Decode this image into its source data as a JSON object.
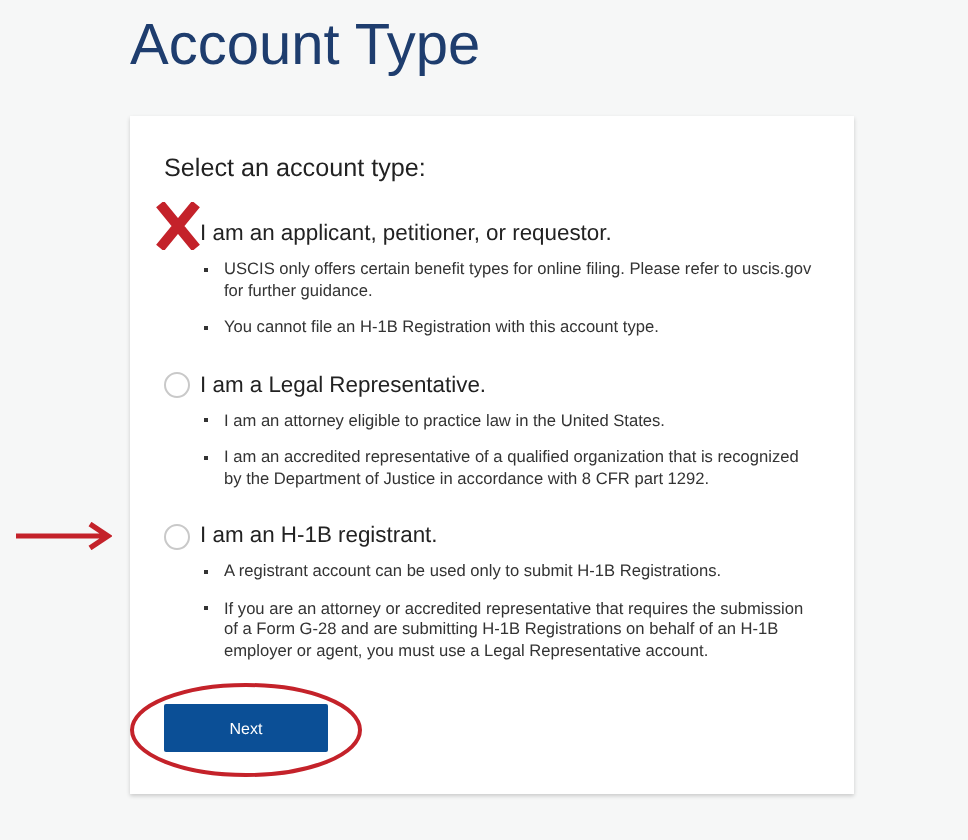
{
  "title": "Account Type",
  "card": {
    "heading": "Select an account type:",
    "options": [
      {
        "label": "I am an applicant, petitioner, or requestor.",
        "kind": "crossed",
        "bullets": [
          "USCIS only offers certain benefit types for online filing. Please refer to uscis.gov for further guidance.",
          "You cannot file an H-1B Registration with this account type."
        ]
      },
      {
        "label": "I am a Legal Representative.",
        "selected": false,
        "kind": "plain",
        "bullets": [
          "I am an attorney eligible to practice law in the United States.",
          "I am an accredited representative of a qualified organization that is recognized by the Department of Justice in accordance with 8 CFR part 1292."
        ]
      },
      {
        "label": "I am an H-1B registrant.",
        "selected": false,
        "kind": "arrowed",
        "bullets": [
          "A registrant account can be used only to submit H-1B Registrations.",
          "If you are an attorney or accredited representative that requires the submission of a Form G-28 and are submitting H-1B Registrations on behalf of an H-1B employer or agent, you must use a Legal Representative account."
        ]
      }
    ],
    "button": {
      "label": "Next",
      "circled": true
    }
  }
}
